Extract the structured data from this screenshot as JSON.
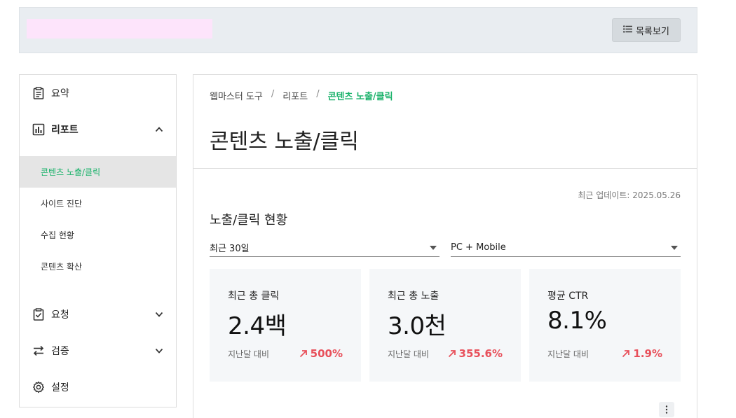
{
  "header": {
    "list_button_label": "목록보기"
  },
  "sidebar": {
    "items": [
      {
        "label": "요약"
      },
      {
        "label": "리포트"
      },
      {
        "label": "요청"
      },
      {
        "label": "검증"
      },
      {
        "label": "설정"
      }
    ],
    "report_sub_items": [
      {
        "label": "콘텐츠 노출/클릭"
      },
      {
        "label": "사이트 진단"
      },
      {
        "label": "수집 현황"
      },
      {
        "label": "콘텐츠 확산"
      }
    ]
  },
  "breadcrumb": {
    "root": "웹마스터 도구",
    "parent": "리포트",
    "current": "콘텐츠 노출/클릭",
    "separator": "/"
  },
  "main": {
    "page_title": "콘텐츠 노출/클릭",
    "updated": "최근 업데이트: 2025.05.26",
    "section_title": "노출/클릭 현황",
    "period_select": "최근 30일",
    "device_select": "PC + Mobile",
    "cards": [
      {
        "label": "최근 총 클릭",
        "value": "2.4백",
        "compare": "지난달 대비",
        "delta": "500%"
      },
      {
        "label": "최근 총 노출",
        "value": "3.0천",
        "compare": "지난달 대비",
        "delta": "355.6%"
      },
      {
        "label": "평균 CTR",
        "value": "8.1%",
        "compare": "지난달 대비",
        "delta": "1.9%"
      }
    ]
  },
  "colors": {
    "accent": "#1bb26b",
    "delta_up": "#e8505b"
  }
}
